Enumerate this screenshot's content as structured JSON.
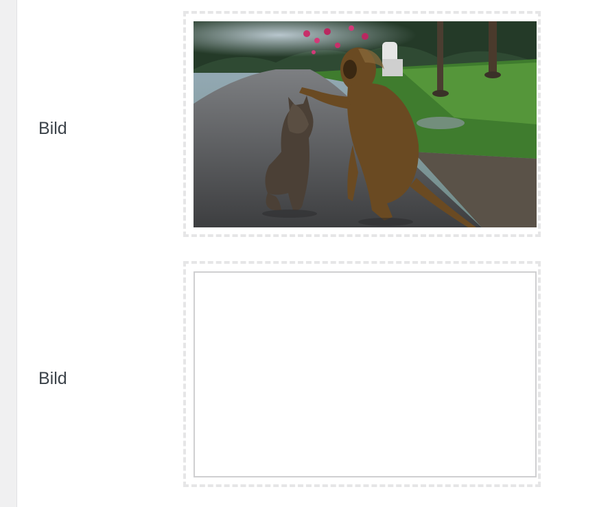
{
  "fields": [
    {
      "label": "Bild",
      "has_image": true,
      "image_description_icon": "photo-cat-and-monkey-image"
    },
    {
      "label": "Bild",
      "has_image": false
    }
  ],
  "colors": {
    "side_strip": "#f0f0f1",
    "label_text": "#3c434a",
    "dashed_border": "#e6e6e7",
    "placeholder_border": "#cfcfd1"
  }
}
